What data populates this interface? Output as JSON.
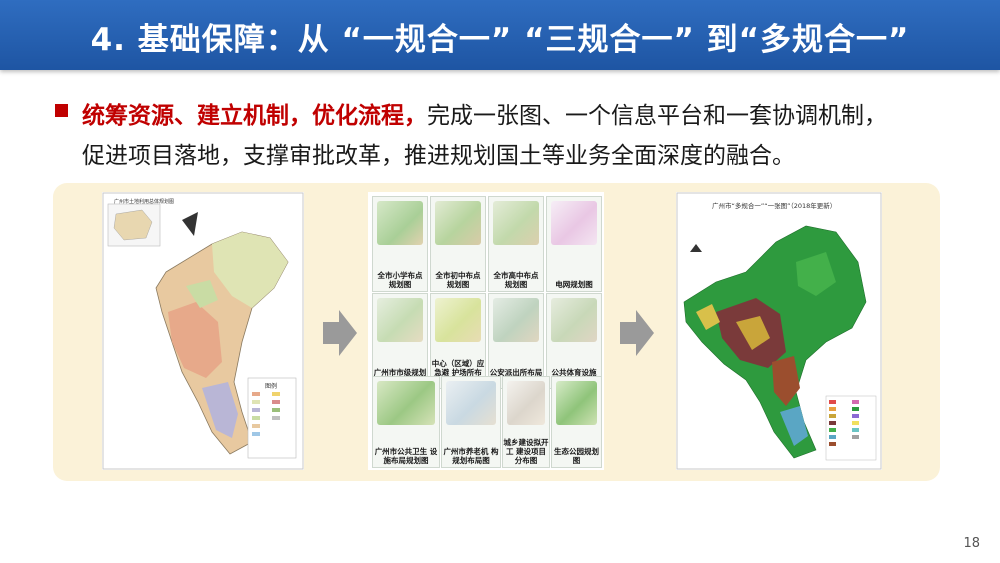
{
  "slide": {
    "title": "4. 基础保障：从 “一规合一” “三规合一” 到“多规合一”",
    "body": {
      "highlight": "统筹资源、建立机制，优化流程，",
      "line1_rest": "完成一张图、一个信息平台和一套协调机制，",
      "line2": "促进项目落地，支撑审批改革，推进规划国土等业务全面深度的融合。"
    },
    "page_number": "18"
  },
  "left_map": {
    "title": "广州市土地利用总体规划图",
    "legend_title": "图例"
  },
  "right_map": {
    "title": "广州市“多规合一”“一张图”（2018年更新）"
  },
  "thumbnails": [
    {
      "caption": "全市小学布点 规划图"
    },
    {
      "caption": "全市初中布点 规划图"
    },
    {
      "caption": "全市高中布点 规划图"
    },
    {
      "caption": "电网规划图"
    },
    {
      "caption": "广州市市级规划 消防站布局图"
    },
    {
      "caption": "中心（区域）应急避 护场所布点规划图"
    },
    {
      "caption": "公安派出所布局 规划图"
    },
    {
      "caption": "公共体育设施 布局规划图"
    },
    {
      "caption": "广州市公共卫生 设施布局规划图"
    },
    {
      "caption": "广州市养老机 构规划布局图"
    },
    {
      "caption": "城乡建设拟开工 建设项目分布图"
    },
    {
      "caption": "生态公园规划图"
    }
  ],
  "colors": {
    "title_bar": "#2060b0",
    "highlight": "#c00000",
    "panel": "#fbf2d8",
    "arrow": "#9a9a9a"
  }
}
